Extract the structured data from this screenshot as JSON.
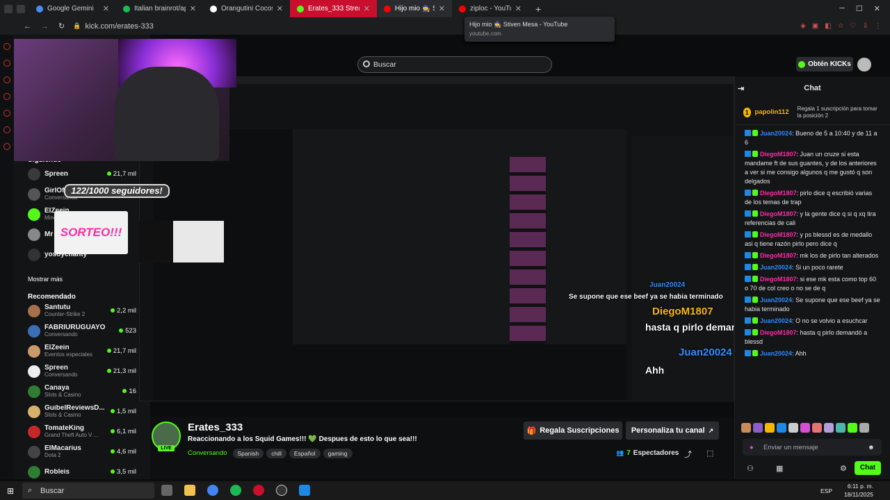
{
  "browser": {
    "tabs": [
      {
        "label": "Google Gemini",
        "favicon_color": "#4b8bf5"
      },
      {
        "label": "Italian brainrot/appearing",
        "favicon_color": "#1db954"
      },
      {
        "label": "Orangutini Cocosini - Bu",
        "favicon_color": "#ffffff"
      },
      {
        "label": "Erates_333 Stream - Wat",
        "favicon_color": "#53fc18",
        "active": true
      },
      {
        "label": "Hijo mio 🧙 Stiven",
        "favicon_color": "#ff0000",
        "hover": true
      },
      {
        "label": "ziploc - YouTube",
        "favicon_color": "#ff0000"
      }
    ],
    "new_tab_label": "+",
    "url": "kick.com/erates-333",
    "tooltip": {
      "title": "Hijo mio 🧙 Stiven Mesa - YouTube",
      "domain": "youtube.com"
    }
  },
  "header": {
    "search_placeholder": "Buscar",
    "get_kicks_label": "Obtén KICKs"
  },
  "sidebar": {
    "following_heading": "Siguiendo",
    "following": [
      {
        "name": "Spreen",
        "viewers": "21,7 mil",
        "avatar_color": "#3a3a3a"
      },
      {
        "name": "GirlOfNox",
        "category": "Conversando",
        "viewers": "",
        "avatar_color": "#555"
      },
      {
        "name": "ElZeein",
        "category": "Minecraft",
        "viewers": "",
        "avatar_color": "#53fc18"
      },
      {
        "name": "Mr",
        "category": "",
        "viewers": "",
        "avatar_color": "#888"
      },
      {
        "name": "yosoychanty",
        "category": "",
        "viewers": "",
        "avatar_color": "#333"
      }
    ],
    "show_more": "Mostrar más",
    "recommended_heading": "Recomendado",
    "recommended": [
      {
        "name": "Santutu",
        "category": "Counter-Strike 2",
        "viewers": "2,2 mil",
        "avatar_color": "#a86f4b"
      },
      {
        "name": "FABRIURUGUAYO",
        "category": "Conversando",
        "viewers": "523",
        "avatar_color": "#3b6fb5"
      },
      {
        "name": "ElZeein",
        "category": "Eventos especiales",
        "viewers": "21,7 mil",
        "avatar_color": "#c99a6a"
      },
      {
        "name": "Spreen",
        "category": "Conversando",
        "viewers": "21,3 mil",
        "avatar_color": "#eeeeee"
      },
      {
        "name": "Canaya",
        "category": "Slots & Casino",
        "viewers": "16",
        "avatar_color": "#2e7d32"
      },
      {
        "name": "GuibelReviewsD...",
        "category": "Slots & Casino",
        "viewers": "1,5 mil",
        "avatar_color": "#d8b26a"
      },
      {
        "name": "TomateKing",
        "category": "Grand Theft Auto V ...",
        "viewers": "6,1 mil",
        "avatar_color": "#c62828"
      },
      {
        "name": "ElMacarius",
        "category": "Dota 2",
        "viewers": "4,6 mil",
        "avatar_color": "#444"
      },
      {
        "name": "Robleis",
        "category": "",
        "viewers": "3,5 mil",
        "avatar_color": "#2e7d32"
      }
    ]
  },
  "stream_overlays": {
    "follower_goal": "122/1000 seguidores!",
    "giveaway": "SORTEO!!!"
  },
  "stream": {
    "streamer": "Erates_333",
    "live_badge": "LIVE",
    "title": "Reaccionando a los Squid Games!!! 💚 Despues de esto lo que sea!!!",
    "category": "Conversando",
    "tags": [
      "Spanish",
      "chill",
      "Español",
      "gaming"
    ],
    "gift_subs_label": "Regala Suscripciones",
    "customize_label": "Personaliza tu canal",
    "viewers": "7",
    "viewers_label": "Espectadores"
  },
  "chat": {
    "title": "Chat",
    "pinned": {
      "user": "papolin112",
      "text": "Regala 1 suscripción para tomar la posición 2"
    },
    "messages": [
      {
        "user": "Juan20024",
        "color": "#2d8cff",
        "text": "Bueno de 5 a 10:40 y de 11 a 6"
      },
      {
        "user": "DiegoM1807",
        "color": "#ff2aa8",
        "text": "Juan un cruze si esta mandame ft de sus guantes, y de los anteriores a ver si me consigo algunos q me gustó q son delgados"
      },
      {
        "user": "DiegoM1807",
        "color": "#ff2aa8",
        "text": "pirlo dice q escribió varias de los temas de trap"
      },
      {
        "user": "DiegoM1807",
        "color": "#ff2aa8",
        "text": "y la gente dice q si q xq tira referencias de cali"
      },
      {
        "user": "DiegoM1807",
        "color": "#ff2aa8",
        "text": "y ps blessd es de medallo asi q tiene razón pirlo pero dice q"
      },
      {
        "user": "DiegoM1807",
        "color": "#ff2aa8",
        "text": "mk los de pirlo tan alterados"
      },
      {
        "user": "Juan20024",
        "color": "#2d8cff",
        "text": "Si un poco rarete"
      },
      {
        "user": "DiegoM1807",
        "color": "#ff2aa8",
        "text": "si ese mk esta como top 60 o 70 de col creo o no se de q"
      },
      {
        "user": "Juan20024",
        "color": "#2d8cff",
        "text": "Se supone que ese beef ya se habia terminado"
      },
      {
        "user": "Juan20024",
        "color": "#2d8cff",
        "text": "O no se volvio a esuchcar"
      },
      {
        "user": "DiegoM1807",
        "color": "#ff2aa8",
        "text": "hasta q pirlo demandó a blessd"
      },
      {
        "user": "Juan20024",
        "color": "#2d8cff",
        "text": "Ahh"
      }
    ],
    "input_placeholder": "Enviar un mensaje",
    "send_label": "Chat"
  },
  "overlay_chat": [
    {
      "user": "Juan20024",
      "text": "Se supone que ese beef ya se habia terminado"
    },
    {
      "user": "DiegoM1807",
      "text": "hasta q pirlo demandó a blessd"
    },
    {
      "user": "Juan20024",
      "text": "Ahh"
    }
  ],
  "taskbar": {
    "search_placeholder": "Buscar",
    "language": "ESP",
    "time": "6:11 p. m.",
    "date": "18/11/2025"
  },
  "colors": {
    "kick_green": "#53fc18",
    "active_tab": "#c8102e"
  }
}
